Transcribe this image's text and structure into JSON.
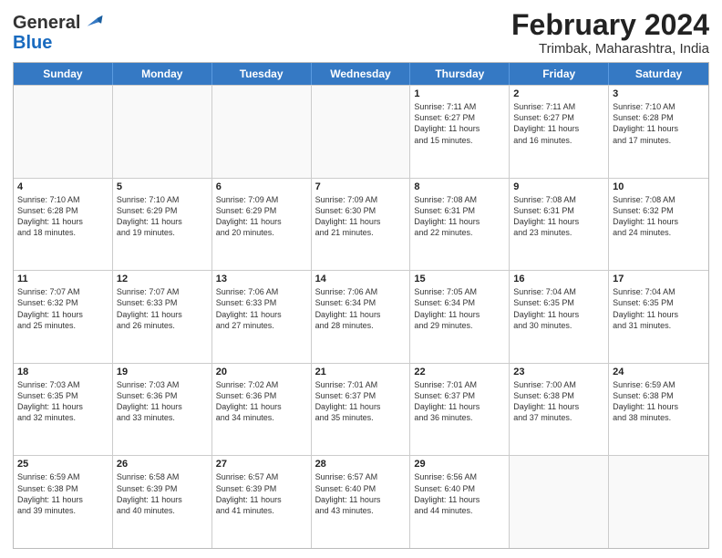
{
  "header": {
    "logo_general": "General",
    "logo_blue": "Blue",
    "month_year": "February 2024",
    "location": "Trimbak, Maharashtra, India"
  },
  "days_of_week": [
    "Sunday",
    "Monday",
    "Tuesday",
    "Wednesday",
    "Thursday",
    "Friday",
    "Saturday"
  ],
  "weeks": [
    [
      {
        "day": "",
        "info": ""
      },
      {
        "day": "",
        "info": ""
      },
      {
        "day": "",
        "info": ""
      },
      {
        "day": "",
        "info": ""
      },
      {
        "day": "1",
        "info": "Sunrise: 7:11 AM\nSunset: 6:27 PM\nDaylight: 11 hours\nand 15 minutes."
      },
      {
        "day": "2",
        "info": "Sunrise: 7:11 AM\nSunset: 6:27 PM\nDaylight: 11 hours\nand 16 minutes."
      },
      {
        "day": "3",
        "info": "Sunrise: 7:10 AM\nSunset: 6:28 PM\nDaylight: 11 hours\nand 17 minutes."
      }
    ],
    [
      {
        "day": "4",
        "info": "Sunrise: 7:10 AM\nSunset: 6:28 PM\nDaylight: 11 hours\nand 18 minutes."
      },
      {
        "day": "5",
        "info": "Sunrise: 7:10 AM\nSunset: 6:29 PM\nDaylight: 11 hours\nand 19 minutes."
      },
      {
        "day": "6",
        "info": "Sunrise: 7:09 AM\nSunset: 6:29 PM\nDaylight: 11 hours\nand 20 minutes."
      },
      {
        "day": "7",
        "info": "Sunrise: 7:09 AM\nSunset: 6:30 PM\nDaylight: 11 hours\nand 21 minutes."
      },
      {
        "day": "8",
        "info": "Sunrise: 7:08 AM\nSunset: 6:31 PM\nDaylight: 11 hours\nand 22 minutes."
      },
      {
        "day": "9",
        "info": "Sunrise: 7:08 AM\nSunset: 6:31 PM\nDaylight: 11 hours\nand 23 minutes."
      },
      {
        "day": "10",
        "info": "Sunrise: 7:08 AM\nSunset: 6:32 PM\nDaylight: 11 hours\nand 24 minutes."
      }
    ],
    [
      {
        "day": "11",
        "info": "Sunrise: 7:07 AM\nSunset: 6:32 PM\nDaylight: 11 hours\nand 25 minutes."
      },
      {
        "day": "12",
        "info": "Sunrise: 7:07 AM\nSunset: 6:33 PM\nDaylight: 11 hours\nand 26 minutes."
      },
      {
        "day": "13",
        "info": "Sunrise: 7:06 AM\nSunset: 6:33 PM\nDaylight: 11 hours\nand 27 minutes."
      },
      {
        "day": "14",
        "info": "Sunrise: 7:06 AM\nSunset: 6:34 PM\nDaylight: 11 hours\nand 28 minutes."
      },
      {
        "day": "15",
        "info": "Sunrise: 7:05 AM\nSunset: 6:34 PM\nDaylight: 11 hours\nand 29 minutes."
      },
      {
        "day": "16",
        "info": "Sunrise: 7:04 AM\nSunset: 6:35 PM\nDaylight: 11 hours\nand 30 minutes."
      },
      {
        "day": "17",
        "info": "Sunrise: 7:04 AM\nSunset: 6:35 PM\nDaylight: 11 hours\nand 31 minutes."
      }
    ],
    [
      {
        "day": "18",
        "info": "Sunrise: 7:03 AM\nSunset: 6:35 PM\nDaylight: 11 hours\nand 32 minutes."
      },
      {
        "day": "19",
        "info": "Sunrise: 7:03 AM\nSunset: 6:36 PM\nDaylight: 11 hours\nand 33 minutes."
      },
      {
        "day": "20",
        "info": "Sunrise: 7:02 AM\nSunset: 6:36 PM\nDaylight: 11 hours\nand 34 minutes."
      },
      {
        "day": "21",
        "info": "Sunrise: 7:01 AM\nSunset: 6:37 PM\nDaylight: 11 hours\nand 35 minutes."
      },
      {
        "day": "22",
        "info": "Sunrise: 7:01 AM\nSunset: 6:37 PM\nDaylight: 11 hours\nand 36 minutes."
      },
      {
        "day": "23",
        "info": "Sunrise: 7:00 AM\nSunset: 6:38 PM\nDaylight: 11 hours\nand 37 minutes."
      },
      {
        "day": "24",
        "info": "Sunrise: 6:59 AM\nSunset: 6:38 PM\nDaylight: 11 hours\nand 38 minutes."
      }
    ],
    [
      {
        "day": "25",
        "info": "Sunrise: 6:59 AM\nSunset: 6:38 PM\nDaylight: 11 hours\nand 39 minutes."
      },
      {
        "day": "26",
        "info": "Sunrise: 6:58 AM\nSunset: 6:39 PM\nDaylight: 11 hours\nand 40 minutes."
      },
      {
        "day": "27",
        "info": "Sunrise: 6:57 AM\nSunset: 6:39 PM\nDaylight: 11 hours\nand 41 minutes."
      },
      {
        "day": "28",
        "info": "Sunrise: 6:57 AM\nSunset: 6:40 PM\nDaylight: 11 hours\nand 43 minutes."
      },
      {
        "day": "29",
        "info": "Sunrise: 6:56 AM\nSunset: 6:40 PM\nDaylight: 11 hours\nand 44 minutes."
      },
      {
        "day": "",
        "info": ""
      },
      {
        "day": "",
        "info": ""
      }
    ]
  ]
}
